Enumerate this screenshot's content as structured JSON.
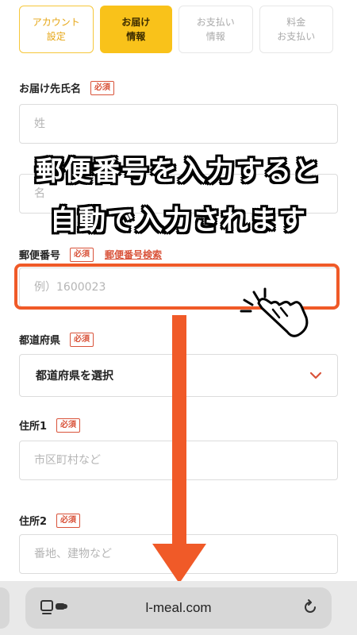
{
  "steps": [
    {
      "label": "アカウント\n設定",
      "state": "done"
    },
    {
      "label": "お届け\n情報",
      "state": "active"
    },
    {
      "label": "お支払い\n情報",
      "state": "todo"
    },
    {
      "label": "料金\nお支払い",
      "state": "todo"
    }
  ],
  "form": {
    "name_label": "お届け先氏名",
    "required": "必須",
    "last_name_placeholder": "姓",
    "first_name_placeholder": "名",
    "postal_label": "郵便番号",
    "postal_search_link": "郵便番号検索",
    "postal_placeholder": "例）1600023",
    "prefecture_label": "都道府県",
    "prefecture_value": "都道府県を選択",
    "address1_label": "住所1",
    "address1_placeholder": "市区町村など",
    "address2_label": "住所2",
    "address2_placeholder": "番地、建物など"
  },
  "overlay": {
    "line1": "郵便番号を入力すると",
    "line2": "自動で入力されます"
  },
  "browser": {
    "url": "l-meal.com"
  },
  "colors": {
    "accent": "#f9c21a",
    "required": "#d9533a",
    "annotation": "#f05a28"
  }
}
